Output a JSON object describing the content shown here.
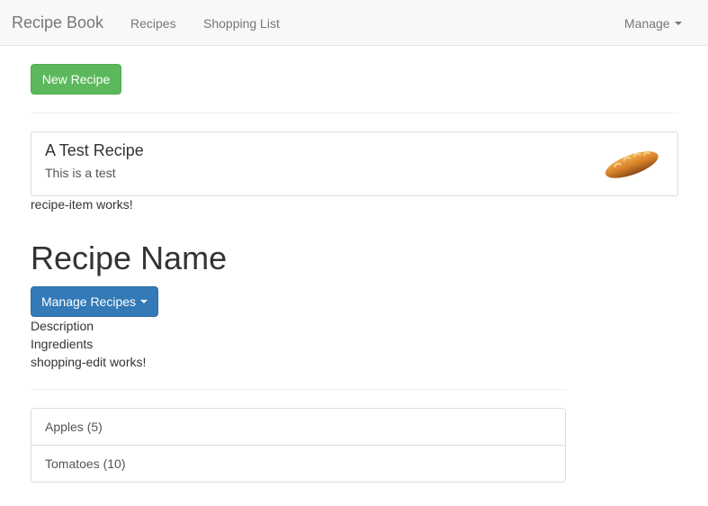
{
  "navbar": {
    "brand": "Recipe Book",
    "links": [
      {
        "label": "Recipes"
      },
      {
        "label": "Shopping List"
      }
    ],
    "manage": {
      "label": "Manage"
    }
  },
  "actions": {
    "new_recipe_label": "New Recipe"
  },
  "recipe_item": {
    "title": "A Test Recipe",
    "description": "This is a test",
    "image_icon": "bread-loaf-image"
  },
  "recipe_item_works": "recipe-item works!",
  "recipe_detail": {
    "name": "Recipe Name",
    "manage_label": "Manage Recipes",
    "description_label": "Description",
    "ingredients_label": "Ingredients"
  },
  "shopping_edit_works": "shopping-edit works!",
  "shopping_list": [
    {
      "label": "Apples (5)"
    },
    {
      "label": "Tomatoes (10)"
    }
  ],
  "colors": {
    "success": "#5cb85c",
    "primary": "#337ab7",
    "navbar_bg": "#f8f8f8"
  }
}
